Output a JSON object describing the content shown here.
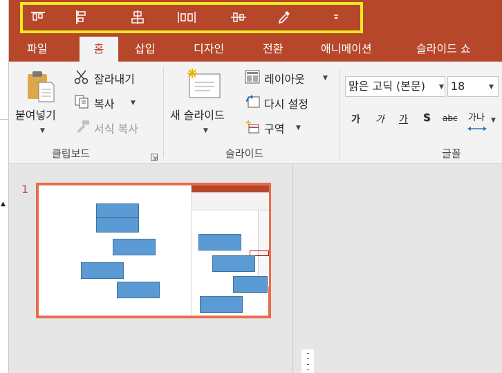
{
  "qat": {
    "buttons": [
      {
        "name": "align-top-icon"
      },
      {
        "name": "align-left-icon"
      },
      {
        "name": "align-center-icon"
      },
      {
        "name": "distribute-horizontally-icon"
      },
      {
        "name": "align-middle-icon"
      },
      {
        "name": "eyedropper-icon"
      },
      {
        "name": "customize-qat-icon"
      }
    ],
    "highlight_color": "#f0ea22"
  },
  "tabs": [
    "파일",
    "홈",
    "삽입",
    "디자인",
    "전환",
    "애니메이션",
    "슬라이드 쇼"
  ],
  "active_tab": "홈",
  "colors": {
    "accent": "#b7472a",
    "ribbon_bg": "#f3f3f3",
    "shape_fill": "#5b9bd5",
    "thumb_border": "#e96c4c"
  },
  "clipboard": {
    "paste_label": "붙여넣기",
    "cut_label": "잘라내기",
    "copy_label": "복사",
    "format_painter_label": "서식 복사",
    "group_label": "클립보드"
  },
  "slides": {
    "new_slide_label": "새 슬라이드",
    "layout_label": "레이아웃",
    "reset_label": "다시 설정",
    "section_label": "구역",
    "group_label": "슬라이드"
  },
  "font": {
    "font_name": "맑은 고딕 (본문)",
    "font_size": "18",
    "bold": "가",
    "italic": "가",
    "underline": "가",
    "shadow": "S",
    "strike": "abc",
    "spacing": "가나",
    "group_label": "글꼴"
  },
  "thumbnail": {
    "slide_number": "1"
  }
}
